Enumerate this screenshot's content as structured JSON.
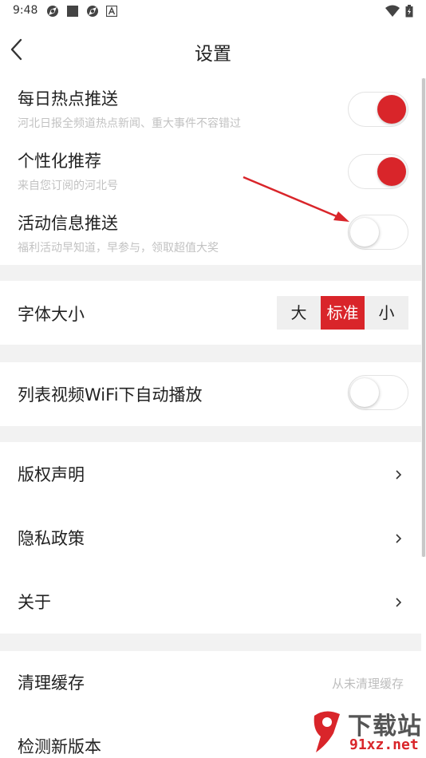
{
  "status_bar": {
    "time": "9:48",
    "icons": [
      "aperture-icon",
      "square-icon",
      "aperture-icon",
      "font-a-icon",
      "wifi-icon",
      "battery-charging-icon"
    ]
  },
  "header": {
    "title": "设置",
    "back_icon": "chevron-left-icon"
  },
  "push_settings": [
    {
      "label": "每日热点推送",
      "desc": "河北日报全频道热点新闻、重大事件不容错过",
      "enabled": true
    },
    {
      "label": "个性化推荐",
      "desc": "来自您订阅的河北号",
      "enabled": true
    },
    {
      "label": "活动信息推送",
      "desc": "福利活动早知道，早参与，领取超值大奖",
      "enabled": false
    }
  ],
  "font_size": {
    "label": "字体大小",
    "options": [
      "大",
      "标准",
      "小"
    ],
    "selected": "标准"
  },
  "autoplay": {
    "label": "列表视频WiFi下自动播放",
    "enabled": false
  },
  "links": [
    {
      "label": "版权声明"
    },
    {
      "label": "隐私政策"
    },
    {
      "label": "关于"
    }
  ],
  "cache": {
    "label": "清理缓存",
    "value": "从未清理缓存"
  },
  "update": {
    "label": "检测新版本"
  },
  "watermark": {
    "text_top": "下载站",
    "text_bottom": "91xz.net"
  },
  "colors": {
    "accent": "#d9252a",
    "divider_band": "#f2f2f2",
    "subtext": "#c2c2c2"
  }
}
